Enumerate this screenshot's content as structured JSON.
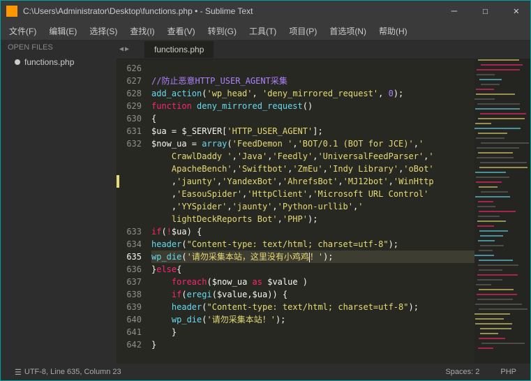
{
  "titlebar": {
    "title": "C:\\Users\\Administrator\\Desktop\\functions.php • - Sublime Text"
  },
  "win_controls": {
    "min": "–",
    "max": "☐",
    "close": "✕"
  },
  "menu": [
    "文件(F)",
    "编辑(E)",
    "选择(S)",
    "查找(I)",
    "查看(V)",
    "转到(G)",
    "工具(T)",
    "项目(P)",
    "首选项(N)",
    "帮助(H)"
  ],
  "sidebar": {
    "header": "OPEN FILES",
    "items": [
      {
        "label": "functions.php"
      }
    ]
  },
  "tabs": {
    "nav_left": "◀",
    "nav_right": "▶",
    "items": [
      {
        "label": "functions.php"
      }
    ]
  },
  "gutter": [
    "626",
    "627",
    "628",
    "629",
    "630",
    "631",
    "632",
    " ",
    " ",
    " ",
    " ",
    " ",
    " ",
    "633",
    "634",
    "635",
    "636",
    "637",
    "638",
    "639",
    "640",
    "641",
    "642"
  ],
  "active_line_index": 15,
  "code": [
    {
      "segs": [
        {
          "t": ""
        }
      ]
    },
    {
      "segs": [
        {
          "t": "//防止恶意HTTP_USER_AGENT采集",
          "c": "st-cm"
        }
      ]
    },
    {
      "segs": [
        {
          "t": "add_action",
          "c": "st-fn"
        },
        {
          "t": "("
        },
        {
          "t": "'wp_head'",
          "c": "st-str"
        },
        {
          "t": ", "
        },
        {
          "t": "'deny_mirrored_request'",
          "c": "st-str"
        },
        {
          "t": ", "
        },
        {
          "t": "0",
          "c": "st-num"
        },
        {
          "t": ");"
        }
      ]
    },
    {
      "segs": [
        {
          "t": "function ",
          "c": "st-kw"
        },
        {
          "t": "deny_mirrored_request",
          "c": "st-fn"
        },
        {
          "t": "()"
        }
      ]
    },
    {
      "segs": [
        {
          "t": "{"
        }
      ]
    },
    {
      "segs": [
        {
          "t": "$ua",
          "c": "st-var"
        },
        {
          "t": " = "
        },
        {
          "t": "$_SERVER",
          "c": "st-var"
        },
        {
          "t": "["
        },
        {
          "t": "'HTTP_USER_AGENT'",
          "c": "st-str"
        },
        {
          "t": "];"
        }
      ]
    },
    {
      "segs": [
        {
          "t": "$now_ua",
          "c": "st-var"
        },
        {
          "t": " = "
        },
        {
          "t": "array",
          "c": "st-fn"
        },
        {
          "t": "("
        },
        {
          "t": "'FeedDemon '",
          "c": "st-str"
        },
        {
          "t": ","
        },
        {
          "t": "'BOT/0.1 (BOT for JCE)'",
          "c": "st-str"
        },
        {
          "t": ","
        },
        {
          "t": "'",
          "c": "st-str"
        }
      ]
    },
    {
      "segs": [
        {
          "t": "    CrawlDaddy '",
          "c": "st-str"
        },
        {
          "t": ","
        },
        {
          "t": "'Java'",
          "c": "st-str"
        },
        {
          "t": ","
        },
        {
          "t": "'Feedly'",
          "c": "st-str"
        },
        {
          "t": ","
        },
        {
          "t": "'UniversalFeedParser'",
          "c": "st-str"
        },
        {
          "t": ","
        },
        {
          "t": "'",
          "c": "st-str"
        }
      ]
    },
    {
      "segs": [
        {
          "t": "    ApacheBench'",
          "c": "st-str"
        },
        {
          "t": ","
        },
        {
          "t": "'Swiftbot'",
          "c": "st-str"
        },
        {
          "t": ","
        },
        {
          "t": "'ZmEu'",
          "c": "st-str"
        },
        {
          "t": ","
        },
        {
          "t": "'Indy Library'",
          "c": "st-str"
        },
        {
          "t": ","
        },
        {
          "t": "'oBot'",
          "c": "st-str"
        }
      ]
    },
    {
      "segs": [
        {
          "t": "    ,"
        },
        {
          "t": "'jaunty'",
          "c": "st-str"
        },
        {
          "t": ","
        },
        {
          "t": "'YandexBot'",
          "c": "st-str"
        },
        {
          "t": ","
        },
        {
          "t": "'AhrefsBot'",
          "c": "st-str"
        },
        {
          "t": ","
        },
        {
          "t": "'MJ12bot'",
          "c": "st-str"
        },
        {
          "t": ","
        },
        {
          "t": "'WinHttp",
          "c": "st-str"
        }
      ]
    },
    {
      "segs": [
        {
          "t": "    ,"
        },
        {
          "t": "'EasouSpider'",
          "c": "st-str"
        },
        {
          "t": ","
        },
        {
          "t": "'HttpClient'",
          "c": "st-str"
        },
        {
          "t": ","
        },
        {
          "t": "'Microsoft URL Control'",
          "c": "st-str"
        }
      ]
    },
    {
      "segs": [
        {
          "t": "    ,"
        },
        {
          "t": "'YYSpider'",
          "c": "st-str"
        },
        {
          "t": ","
        },
        {
          "t": "'jaunty'",
          "c": "st-str"
        },
        {
          "t": ","
        },
        {
          "t": "'Python-urllib'",
          "c": "st-str"
        },
        {
          "t": ","
        },
        {
          "t": "'",
          "c": "st-str"
        }
      ]
    },
    {
      "segs": [
        {
          "t": "    lightDeckReports Bot'",
          "c": "st-str"
        },
        {
          "t": ","
        },
        {
          "t": "'PHP'",
          "c": "st-str"
        },
        {
          "t": ");"
        }
      ]
    },
    {
      "segs": [
        {
          "t": "if",
          "c": "st-kw"
        },
        {
          "t": "("
        },
        {
          "t": "!",
          "c": "st-op"
        },
        {
          "t": "$ua",
          "c": "st-var"
        },
        {
          "t": ") {"
        }
      ]
    },
    {
      "segs": [
        {
          "t": "header",
          "c": "st-fn"
        },
        {
          "t": "("
        },
        {
          "t": "\"Content-type: text/html; charset=utf-8\"",
          "c": "st-str"
        },
        {
          "t": ");"
        }
      ]
    },
    {
      "hl": true,
      "segs": [
        {
          "t": "wp_die",
          "c": "st-fn"
        },
        {
          "t": "("
        },
        {
          "t": "'请勿采集本站，这里没有小鸡鸡",
          "c": "st-str"
        },
        {
          "caret": true
        },
        {
          "t": "！'",
          "c": "st-str"
        },
        {
          "t": ");"
        }
      ]
    },
    {
      "segs": [
        {
          "t": "}"
        },
        {
          "t": "else",
          "c": "st-kw"
        },
        {
          "t": "{"
        }
      ]
    },
    {
      "segs": [
        {
          "t": "    "
        },
        {
          "t": "foreach",
          "c": "st-kw"
        },
        {
          "t": "("
        },
        {
          "t": "$now_ua",
          "c": "st-var"
        },
        {
          "t": " "
        },
        {
          "t": "as",
          "c": "st-kw"
        },
        {
          "t": " "
        },
        {
          "t": "$value",
          "c": "st-var"
        },
        {
          "t": " )"
        }
      ]
    },
    {
      "segs": [
        {
          "t": "    "
        },
        {
          "t": "if",
          "c": "st-kw"
        },
        {
          "t": "("
        },
        {
          "t": "eregi",
          "c": "st-fn"
        },
        {
          "t": "("
        },
        {
          "t": "$value",
          "c": "st-var"
        },
        {
          "t": ","
        },
        {
          "t": "$ua",
          "c": "st-var"
        },
        {
          "t": ")) {"
        }
      ]
    },
    {
      "segs": [
        {
          "t": "    "
        },
        {
          "t": "header",
          "c": "st-fn"
        },
        {
          "t": "("
        },
        {
          "t": "\"Content-type: text/html; charset=utf-8\"",
          "c": "st-str"
        },
        {
          "t": ");"
        }
      ]
    },
    {
      "segs": [
        {
          "t": "    "
        },
        {
          "t": "wp_die",
          "c": "st-fn"
        },
        {
          "t": "("
        },
        {
          "t": "'请勿采集本站！'",
          "c": "st-str"
        },
        {
          "t": ");"
        }
      ]
    },
    {
      "segs": [
        {
          "t": "    }"
        }
      ]
    },
    {
      "segs": [
        {
          "t": "}"
        }
      ]
    }
  ],
  "status": {
    "hamburger": "☰",
    "encoding": "UTF-8, Line 635, Column 23",
    "spaces": "Spaces: 2",
    "lang": "PHP"
  }
}
